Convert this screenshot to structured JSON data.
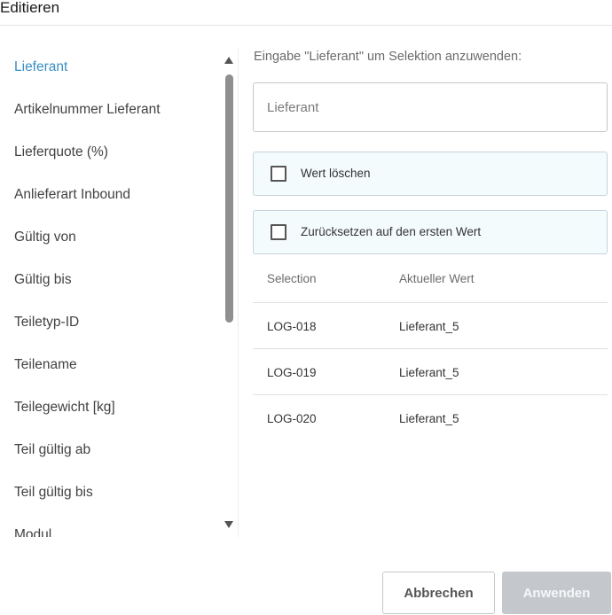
{
  "dialog": {
    "title": "Editieren"
  },
  "fields": {
    "active_index": 0,
    "items": [
      "Lieferant",
      "Artikelnummer Lieferant",
      "Lieferquote (%)",
      "Anlieferart Inbound",
      "Gültig von",
      "Gültig bis",
      "Teiletyp-ID",
      "Teilename",
      "Teilegewicht [kg]",
      "Teil gültig ab",
      "Teil gültig bis",
      "Modul"
    ]
  },
  "panel": {
    "hint": "Eingabe \"Lieferant\" um Selektion anzuwenden:",
    "input": {
      "placeholder": "Lieferant",
      "value": ""
    },
    "options": {
      "clear": {
        "label": "Wert löschen",
        "checked": false
      },
      "reset": {
        "label": "Zurücksetzen auf den ersten Wert",
        "checked": false
      }
    },
    "table": {
      "headers": {
        "selection": "Selection",
        "current": "Aktueller Wert"
      },
      "rows": [
        {
          "selection": "LOG-018",
          "current": "Lieferant_5"
        },
        {
          "selection": "LOG-019",
          "current": "Lieferant_5"
        },
        {
          "selection": "LOG-020",
          "current": "Lieferant_5"
        }
      ]
    }
  },
  "footer": {
    "cancel_label": "Abbrechen",
    "apply_label": "Anwenden"
  },
  "colors": {
    "accent": "#3a8fc3",
    "option_bg": "#f4fbfd",
    "apply_disabled": "#c4c8cc"
  },
  "icons": {
    "scroll_up": "triangle-up-icon",
    "scroll_down": "triangle-down-icon",
    "checkbox": "checkbox-empty-icon"
  }
}
